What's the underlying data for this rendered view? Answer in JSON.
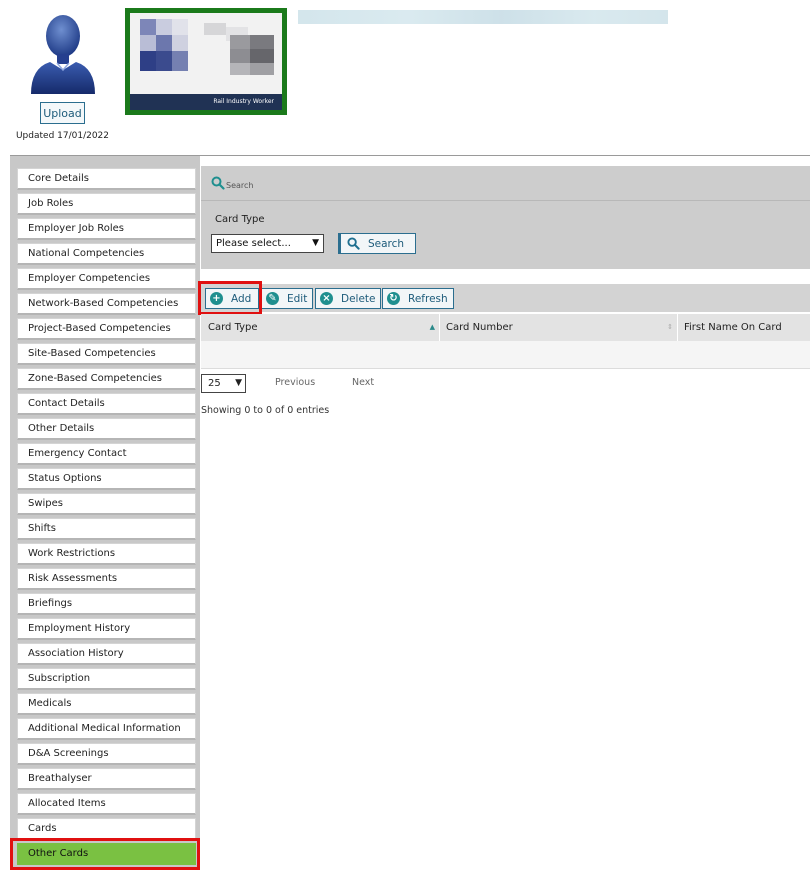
{
  "profile": {
    "upload_label": "Upload",
    "updated_text": "Updated 17/01/2022",
    "card_strip_text": "Rail Industry Worker"
  },
  "sidebar": {
    "items": [
      {
        "label": "Core Details"
      },
      {
        "label": "Job Roles"
      },
      {
        "label": "Employer Job Roles"
      },
      {
        "label": "National Competencies"
      },
      {
        "label": "Employer Competencies"
      },
      {
        "label": "Network-Based Competencies"
      },
      {
        "label": "Project-Based Competencies"
      },
      {
        "label": "Site-Based Competencies"
      },
      {
        "label": "Zone-Based Competencies"
      },
      {
        "label": "Contact Details"
      },
      {
        "label": "Other Details"
      },
      {
        "label": "Emergency Contact"
      },
      {
        "label": "Status Options"
      },
      {
        "label": "Swipes"
      },
      {
        "label": "Shifts"
      },
      {
        "label": "Work Restrictions"
      },
      {
        "label": "Risk Assessments"
      },
      {
        "label": "Briefings"
      },
      {
        "label": "Employment History"
      },
      {
        "label": "Association History"
      },
      {
        "label": "Subscription"
      },
      {
        "label": "Medicals"
      },
      {
        "label": "Additional Medical Information"
      },
      {
        "label": "D&A Screenings"
      },
      {
        "label": "Breathalyser"
      },
      {
        "label": "Allocated Items"
      },
      {
        "label": "Cards"
      },
      {
        "label": "Other Cards",
        "active": true
      }
    ]
  },
  "search": {
    "caption": "Search",
    "card_type_label": "Card Type",
    "select_value": "Please select...",
    "button_label": "Search"
  },
  "toolbar": {
    "add_label": "Add",
    "edit_label": "Edit",
    "delete_label": "Delete",
    "refresh_label": "Refresh"
  },
  "table": {
    "columns": [
      "Card Type",
      "Card Number",
      "First Name On Card"
    ],
    "page_size": "25",
    "previous_label": "Previous",
    "next_label": "Next",
    "showing_text": "Showing 0 to 0 of 0 entries"
  },
  "colors": {
    "accent": "#2b6e8f",
    "active_tab": "#7ac142",
    "highlight": "#e01010",
    "card_border": "#1b7a1b"
  }
}
